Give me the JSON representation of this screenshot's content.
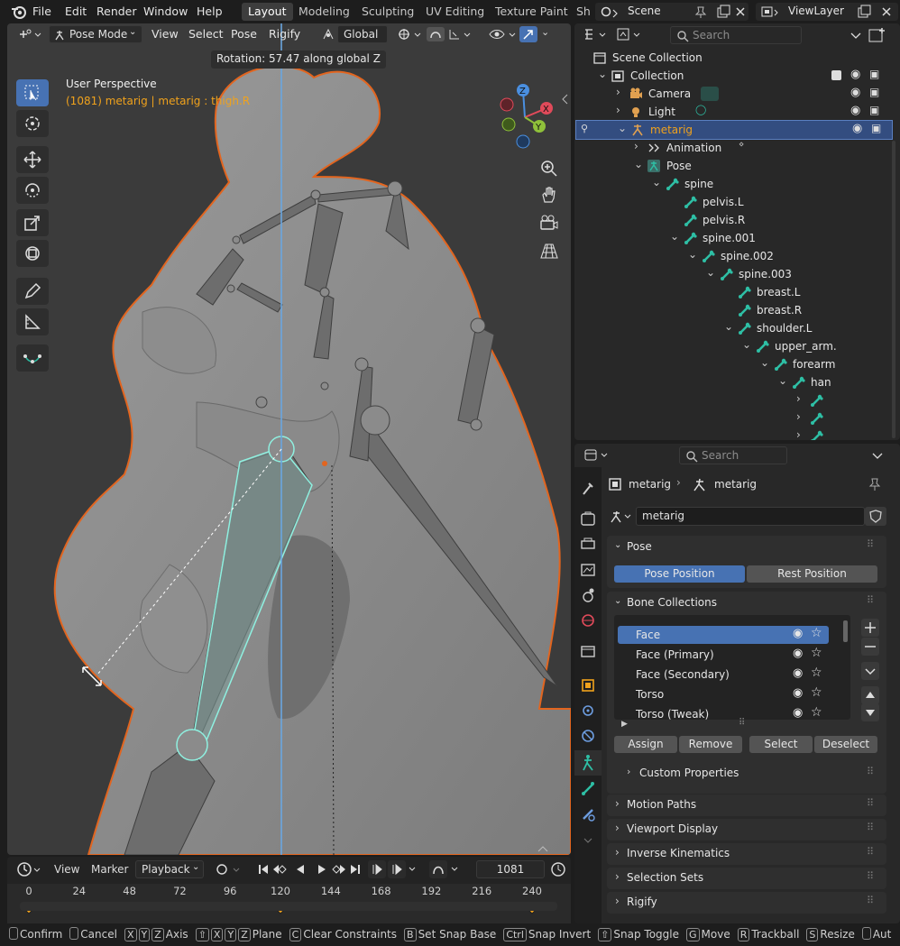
{
  "topbar": {
    "menus": [
      "File",
      "Edit",
      "Render",
      "Window",
      "Help"
    ],
    "workspaces": [
      "Layout",
      "Modeling",
      "Sculpting",
      "UV Editing",
      "Texture Paint",
      "Sh"
    ],
    "active_workspace": "Layout",
    "scene": "Scene",
    "view_layer": "ViewLayer"
  },
  "viewport": {
    "mode": "Pose Mode",
    "menus": [
      "View",
      "Select",
      "Pose",
      "Rigify"
    ],
    "orientation": "Global",
    "operation_text": "Rotation: 57.47 along global Z",
    "overlay_title": "User Perspective",
    "overlay_info": "(1081) metarig | metarig : thigh.R",
    "gizmo_axes": [
      "Z",
      "X",
      "Y"
    ]
  },
  "timeline": {
    "menus": [
      "View",
      "Marker",
      "Playback"
    ],
    "current_frame": "1081",
    "ticks": [
      "0",
      "24",
      "48",
      "72",
      "96",
      "120",
      "144",
      "168",
      "192",
      "216",
      "240"
    ],
    "keyframes": [
      0,
      120,
      240
    ],
    "frame_max": 260
  },
  "statusbar": {
    "items": [
      {
        "keys": [
          ""
        ],
        "label": "Confirm"
      },
      {
        "keys": [
          ""
        ],
        "label": "Cancel"
      },
      {
        "keys": [
          "X",
          "Y",
          "Z"
        ],
        "label": "Axis"
      },
      {
        "keys": [
          "⇧",
          "X",
          "Y",
          "Z"
        ],
        "label": "Plane"
      },
      {
        "keys": [
          "C"
        ],
        "label": "Clear Constraints"
      },
      {
        "keys": [
          "B"
        ],
        "label": "Set Snap Base"
      },
      {
        "keys": [
          "Ctrl"
        ],
        "label": "Snap Invert"
      },
      {
        "keys": [
          "⇧"
        ],
        "label": "Snap Toggle"
      },
      {
        "keys": [
          "G"
        ],
        "label": "Move"
      },
      {
        "keys": [
          "R"
        ],
        "label": "Trackball"
      },
      {
        "keys": [
          "S"
        ],
        "label": "Resize"
      },
      {
        "keys": [
          ""
        ],
        "label": "Aut"
      }
    ]
  },
  "outliner": {
    "search_placeholder": "Search",
    "rows": [
      {
        "label": "Scene Collection",
        "depth": 0,
        "icon": "scene-collection-icon"
      },
      {
        "label": "Collection",
        "depth": 1,
        "icon": "collection-icon"
      },
      {
        "label": "Camera",
        "depth": 2,
        "icon": "camera-icon"
      },
      {
        "label": "Light",
        "depth": 2,
        "icon": "light-icon"
      },
      {
        "label": "metarig",
        "depth": 2,
        "icon": "armature-icon",
        "selected": true
      },
      {
        "label": "Animation",
        "depth": 3,
        "icon": "animation-icon"
      },
      {
        "label": "Pose",
        "depth": 3,
        "icon": "pose-icon"
      },
      {
        "label": "spine",
        "depth": 4,
        "icon": "bone-icon"
      },
      {
        "label": "pelvis.L",
        "depth": 5,
        "icon": "bone-icon"
      },
      {
        "label": "pelvis.R",
        "depth": 5,
        "icon": "bone-icon"
      },
      {
        "label": "spine.001",
        "depth": 5,
        "icon": "bone-icon"
      },
      {
        "label": "spine.002",
        "depth": 6,
        "icon": "bone-icon"
      },
      {
        "label": "spine.003",
        "depth": 7,
        "icon": "bone-icon"
      },
      {
        "label": "breast.L",
        "depth": 8,
        "icon": "bone-icon"
      },
      {
        "label": "breast.R",
        "depth": 8,
        "icon": "bone-icon"
      },
      {
        "label": "shoulder.L",
        "depth": 8,
        "icon": "bone-icon"
      },
      {
        "label": "upper_arm.",
        "depth": 9,
        "icon": "bone-icon"
      },
      {
        "label": "forearm",
        "depth": 10,
        "icon": "bone-icon"
      },
      {
        "label": "han",
        "depth": 11,
        "icon": "bone-icon"
      },
      {
        "label": "",
        "depth": 12,
        "icon": "bone-icon"
      },
      {
        "label": "",
        "depth": 12,
        "icon": "bone-icon"
      },
      {
        "label": "",
        "depth": 12,
        "icon": "bone-icon"
      }
    ]
  },
  "properties": {
    "search_placeholder": "Search",
    "breadcrumb": [
      "metarig",
      "metarig"
    ],
    "data_name": "metarig",
    "pose_panel": {
      "title": "Pose",
      "pose_position": "Pose Position",
      "rest_position": "Rest Position"
    },
    "bone_collections": {
      "title": "Bone Collections",
      "items": [
        "Face",
        "Face (Primary)",
        "Face (Secondary)",
        "Torso",
        "Torso (Tweak)"
      ],
      "assign": "Assign",
      "remove": "Remove",
      "select": "Select",
      "deselect": "Deselect",
      "custom_properties": "Custom Properties"
    },
    "collapsed_panels": [
      "Motion Paths",
      "Viewport Display",
      "Inverse Kinematics",
      "Selection Sets",
      "Rigify"
    ]
  },
  "colors": {
    "accent": "#4772b3",
    "bone": "#2ebfa5",
    "keyframe": "#f0a21c",
    "outline": "#e2651f",
    "viewport": "#3b3b3b"
  }
}
